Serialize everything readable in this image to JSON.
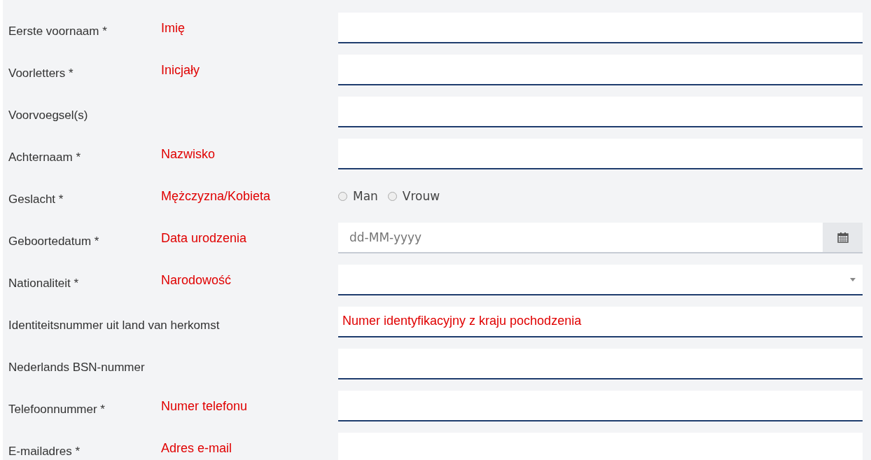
{
  "fields": [
    {
      "label": "Eerste voornaam *",
      "note": "Imię",
      "kind": "text"
    },
    {
      "label": "Voorletters *",
      "note": "Inicjały",
      "kind": "text"
    },
    {
      "label": "Voorvoegsel(s)",
      "kind": "text"
    },
    {
      "label": "Achternaam *",
      "note": "Nazwisko",
      "kind": "text"
    },
    {
      "label": "Geslacht *",
      "note": "Mężczyzna/Kobieta",
      "kind": "radio",
      "options": [
        {
          "label": "Man",
          "selected": false
        },
        {
          "label": "Vrouw",
          "selected": false
        }
      ]
    },
    {
      "label": "Geboortedatum *",
      "note": "Data urodzenia",
      "kind": "date",
      "placeholder": "dd-MM-yyyy"
    },
    {
      "label": "Nationaliteit *",
      "note": "Narodowość",
      "kind": "select"
    },
    {
      "label": "Identiteitsnummer uit land van herkomst",
      "field_note": "Numer identyfikacyjny z kraju pochodzenia",
      "kind": "text"
    },
    {
      "label": "Nederlands BSN-nummer",
      "kind": "text"
    },
    {
      "label": "Telefoonnummer *",
      "note": "Numer telefonu",
      "kind": "text"
    },
    {
      "label": "E-mailadres *",
      "note": "Adres e-mail",
      "kind": "text"
    }
  ]
}
